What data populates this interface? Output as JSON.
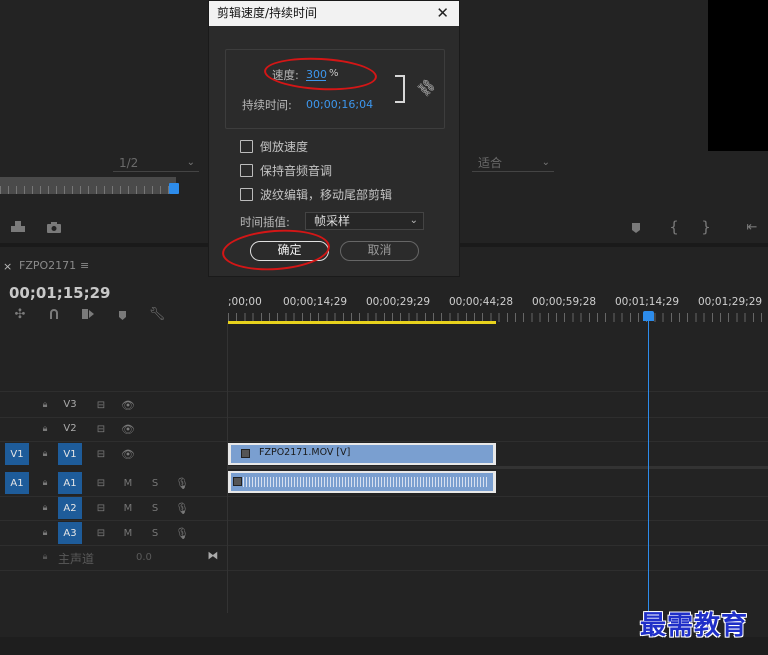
{
  "dialog": {
    "title": "剪辑速度/持续时间",
    "speed_label": "速度:",
    "speed_value": "300",
    "speed_unit": "%",
    "duration_label": "持续时间:",
    "duration_value": "00;00;16;04",
    "options": [
      {
        "label": "倒放速度",
        "checked": false
      },
      {
        "label": "保持音频音调",
        "checked": false
      },
      {
        "label": "波纹编辑，移动尾部剪辑",
        "checked": false
      }
    ],
    "interp_label": "时间插值:",
    "interp_value": "帧采样",
    "ok_label": "确定",
    "cancel_label": "取消"
  },
  "monitor": {
    "resolution_value": "1/2",
    "fit_value": "适合"
  },
  "timeline": {
    "sequence_name": "FZPO2171",
    "timecode": "00;01;15;29",
    "ruler_labels": [
      ";00;00",
      "00;00;14;29",
      "00;00;29;29",
      "00;00;44;28",
      "00;00;59;28",
      "00;01;14;29",
      "00;01;29;29"
    ],
    "video_tracks": [
      {
        "name": "V3",
        "source": ""
      },
      {
        "name": "V2",
        "source": ""
      },
      {
        "name": "V1",
        "source": "V1"
      }
    ],
    "audio_tracks": [
      {
        "name": "A1",
        "source": "A1",
        "mute": "M",
        "solo": "S"
      },
      {
        "name": "A2",
        "source": "",
        "mute": "M",
        "solo": "S"
      },
      {
        "name": "A3",
        "source": "",
        "mute": "M",
        "solo": "S"
      }
    ],
    "master_label": "主声道",
    "master_value": "0.0",
    "video_clip_name": "FZPO2171.MOV [V]"
  },
  "watermark": "最需教育",
  "colors": {
    "accent_blue": "#2d8ceb",
    "annotation_red": "#d41616",
    "work_area_yellow": "#e8d21d",
    "clip_blue": "#7a9fd0"
  }
}
